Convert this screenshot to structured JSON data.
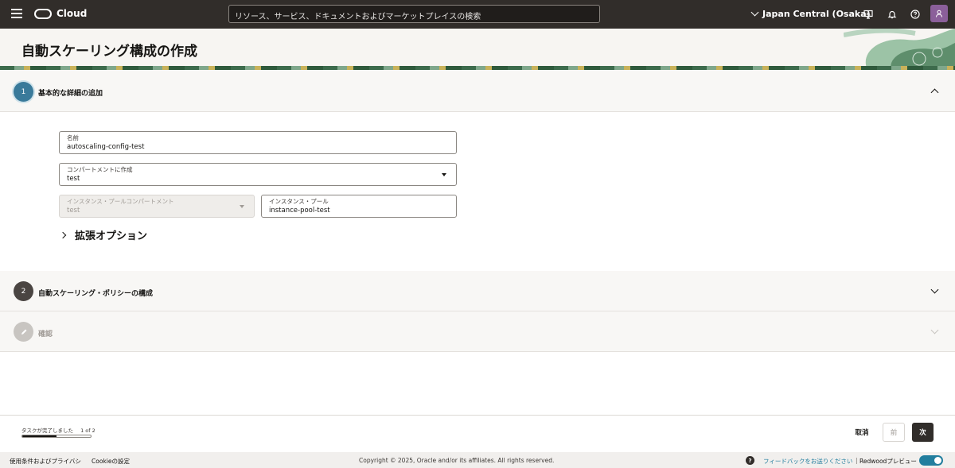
{
  "topbar": {
    "brand": "Cloud",
    "search_placeholder": "リソース、サービス、ドキュメントおよびマーケットプレイスの検索",
    "region": "Japan Central (Osaka)"
  },
  "page": {
    "title": "自動スケーリング構成の作成"
  },
  "steps": [
    {
      "number": "1",
      "label": "基本的な詳細の追加",
      "state": "active"
    },
    {
      "number": "2",
      "label": "自動スケーリング・ポリシーの構成",
      "state": "pending"
    },
    {
      "number": "",
      "label": "確認",
      "state": "disabled"
    }
  ],
  "form": {
    "name": {
      "label": "名前",
      "value": "autoscaling-config-test"
    },
    "compartment": {
      "label": "コンパートメントに作成",
      "value": "test"
    },
    "pool_compartment": {
      "label": "インスタンス・プールコンパートメント",
      "value": "test"
    },
    "instance_pool": {
      "label": "インスタンス・プール",
      "value": "instance-pool-test"
    },
    "advanced_options": "拡張オプション"
  },
  "actionbar": {
    "progress_label": "タスクが完了しました",
    "progress_count": "1 of 2",
    "progress_fraction": 0.5,
    "cancel": "取消",
    "previous": "前",
    "next": "次"
  },
  "bottombar": {
    "terms": "使用条件およびプライバシ",
    "cookie": "Cookieの設定",
    "copyright": "Copyright © 2025, Oracle and/or its affiliates. All rights reserved.",
    "help_glyph": "?",
    "feedback": "フィードバックをお送りください",
    "separator": "|",
    "redwood": "Redwoodプレビュー"
  },
  "colors": {
    "topbar_bg": "#312d2a",
    "step1_circle": "#3a7a9a",
    "step2_circle": "#4a4542",
    "step3_circle": "#c8c5c1",
    "toggle_on": "#227e9e",
    "link": "#227e9e"
  },
  "icons": [
    "hamburger-icon",
    "oracle-logo",
    "chevron-down-icon",
    "developer-tools-icon",
    "bell-icon",
    "help-icon",
    "user-icon",
    "chevron-up-icon",
    "chevron-right-icon",
    "caret-down-icon",
    "pencil-icon"
  ]
}
